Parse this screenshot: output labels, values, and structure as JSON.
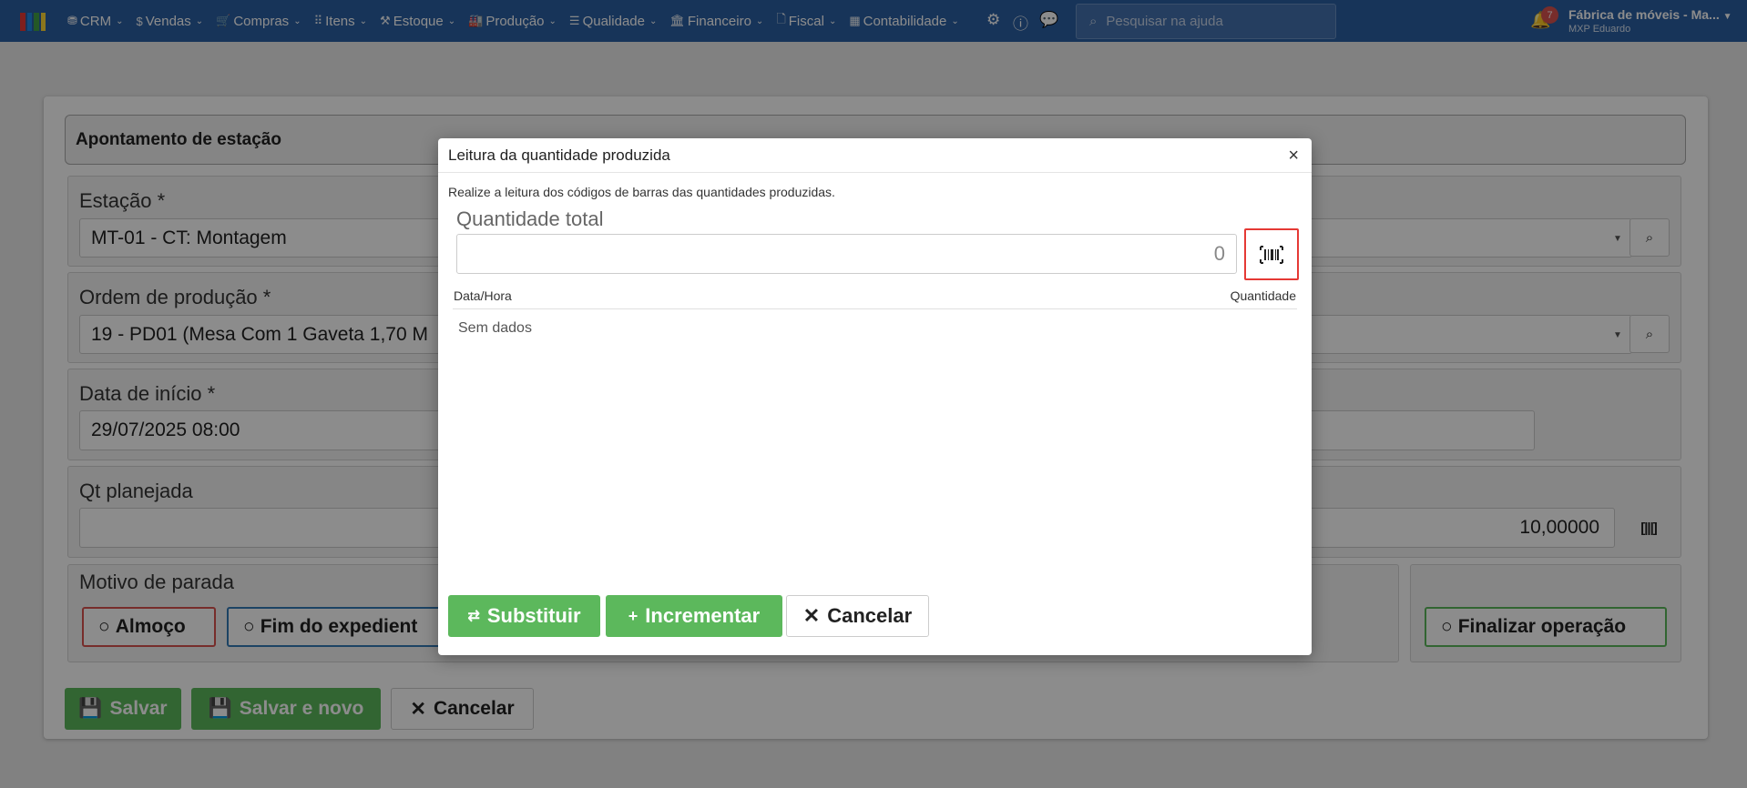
{
  "topbar": {
    "menu": [
      {
        "icon": "users-icon",
        "glyph": "⛃",
        "label": "CRM"
      },
      {
        "icon": "dollar-icon",
        "glyph": "$",
        "label": "Vendas"
      },
      {
        "icon": "cart-icon",
        "glyph": "🛒",
        "label": "Compras"
      },
      {
        "icon": "list-icon",
        "glyph": "⠿",
        "label": "Itens"
      },
      {
        "icon": "warehouse-icon",
        "glyph": "⚒",
        "label": "Estoque"
      },
      {
        "icon": "factory-icon",
        "glyph": "🏭",
        "label": "Produção"
      },
      {
        "icon": "checklist-icon",
        "glyph": "☰",
        "label": "Qualidade"
      },
      {
        "icon": "bank-icon",
        "glyph": "🏛",
        "label": "Financeiro"
      },
      {
        "icon": "document-icon",
        "glyph": "🗋",
        "label": "Fiscal"
      },
      {
        "icon": "calculator-icon",
        "glyph": "▦",
        "label": "Contabilidade"
      }
    ],
    "search_placeholder": "Pesquisar na ajuda",
    "notification_count": "7",
    "company": "Fábrica de móveis - Ma...",
    "user": "MXP Eduardo",
    "colors": {
      "bar": "#2b5fa3",
      "logo": [
        "#e53935",
        "#1e88e5",
        "#43a047",
        "#fdd835"
      ]
    }
  },
  "form": {
    "title": "Apontamento de estação",
    "estacao": {
      "label": "Estação *",
      "value": "MT-01 - CT: Montagem"
    },
    "ordem": {
      "label": "Ordem de produção *",
      "value": "19 - PD01 (Mesa Com 1 Gaveta 1,70 M"
    },
    "data_inicio": {
      "label": "Data de início *",
      "value": "29/07/2025 08:00"
    },
    "qt_planejada": {
      "label": "Qt planejada",
      "value": "10,00000"
    },
    "motivo": {
      "label": "Motivo de parada",
      "options": [
        {
          "label": "Almoço",
          "color": "#d9534f"
        },
        {
          "label": "Fim do expedient",
          "color": "#337ab7"
        }
      ]
    },
    "finalizar_label": "Finalizar operação",
    "buttons": {
      "save": "Salvar",
      "save_new": "Salvar e novo",
      "cancel": "Cancelar"
    }
  },
  "modal": {
    "title": "Leitura da quantidade produzida",
    "close": "×",
    "description": "Realize a leitura dos códigos de barras das quantidades produzidas.",
    "total_label": "Quantidade total",
    "total_value": "0",
    "columns": [
      "Data/Hora",
      "Quantidade"
    ],
    "empty": "Sem dados",
    "buttons": {
      "substituir": "Substituir",
      "incrementar": "Incrementar",
      "cancelar": "Cancelar"
    }
  }
}
